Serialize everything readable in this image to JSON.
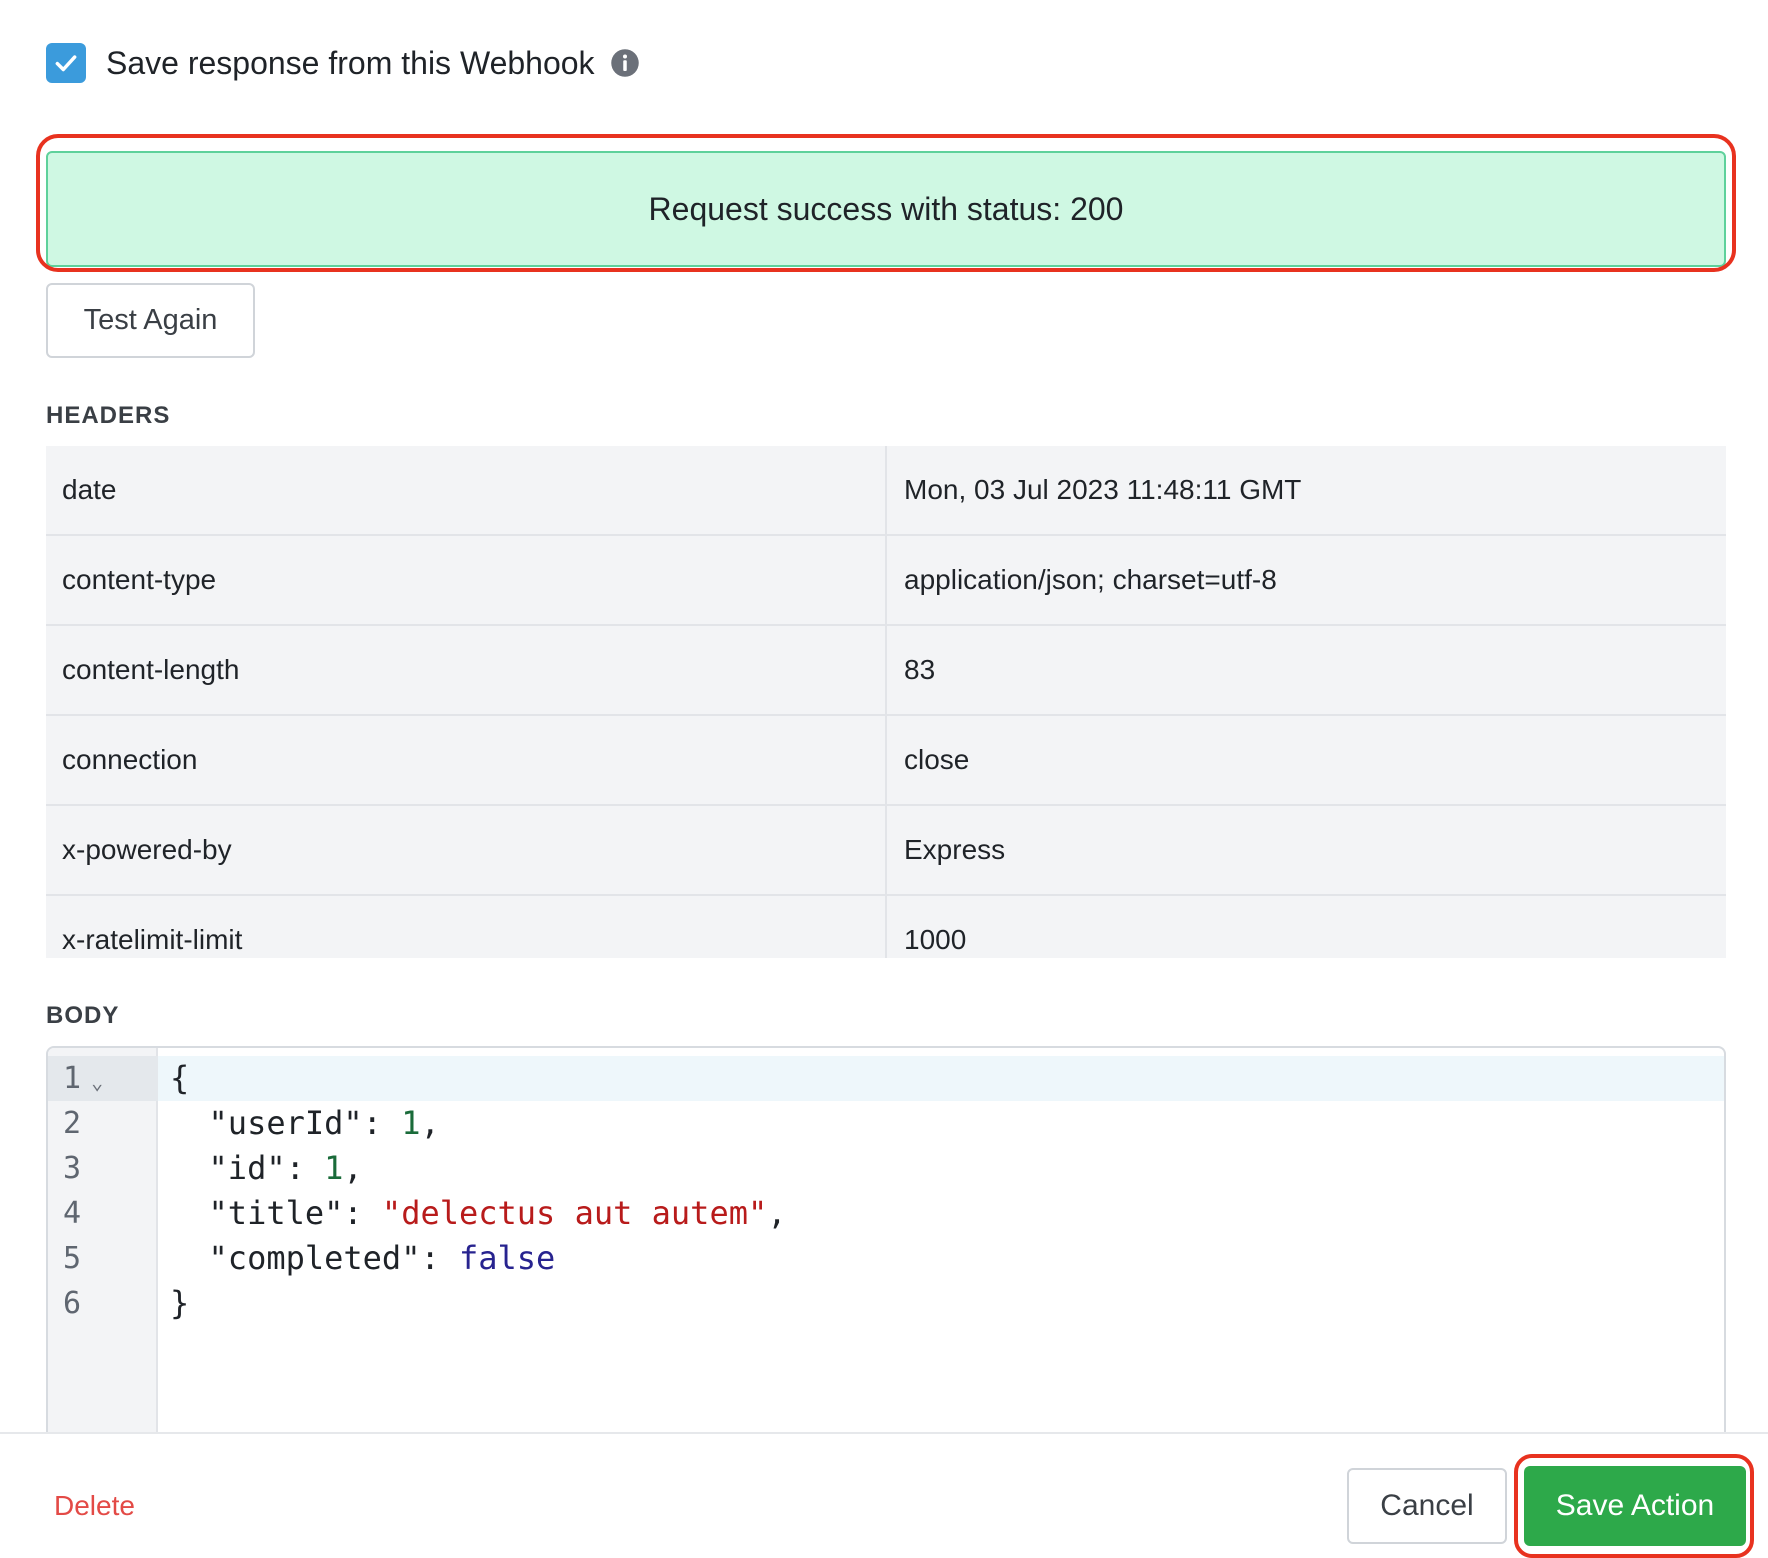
{
  "save_response": {
    "checked": true,
    "label": "Save response from this Webhook",
    "info_icon": "info-icon"
  },
  "status": {
    "message": "Request success with status: 200",
    "color": "#cff8e3"
  },
  "test_again_label": "Test Again",
  "headers": {
    "title": "HEADERS",
    "rows": [
      {
        "key": "date",
        "value": "Mon, 03 Jul 2023 11:48:11 GMT"
      },
      {
        "key": "content-type",
        "value": "application/json; charset=utf-8"
      },
      {
        "key": "content-length",
        "value": "83"
      },
      {
        "key": "connection",
        "value": "close"
      },
      {
        "key": "x-powered-by",
        "value": "Express"
      },
      {
        "key": "x-ratelimit-limit",
        "value": "1000"
      }
    ]
  },
  "body": {
    "title": "BODY",
    "line_numbers": [
      "1",
      "2",
      "3",
      "4",
      "5",
      "6"
    ],
    "lines": [
      {
        "indent": "",
        "key": "",
        "punct": "{"
      },
      {
        "indent": "  ",
        "key": "\"userId\"",
        "sep": ": ",
        "value": "1",
        "type": "num",
        "end": ","
      },
      {
        "indent": "  ",
        "key": "\"id\"",
        "sep": ": ",
        "value": "1",
        "type": "num",
        "end": ","
      },
      {
        "indent": "  ",
        "key": "\"title\"",
        "sep": ": ",
        "value": "\"delectus aut autem\"",
        "type": "str",
        "end": ","
      },
      {
        "indent": "  ",
        "key": "\"completed\"",
        "sep": ": ",
        "value": "false",
        "type": "bool",
        "end": ""
      },
      {
        "indent": "",
        "key": "",
        "punct": "}"
      }
    ]
  },
  "footer": {
    "delete_label": "Delete",
    "cancel_label": "Cancel",
    "save_label": "Save Action"
  },
  "colors": {
    "accent_blue": "#3b9bdc",
    "success_green": "#2da94a",
    "danger_red": "#e34a46",
    "highlight_red": "#e8321f"
  }
}
